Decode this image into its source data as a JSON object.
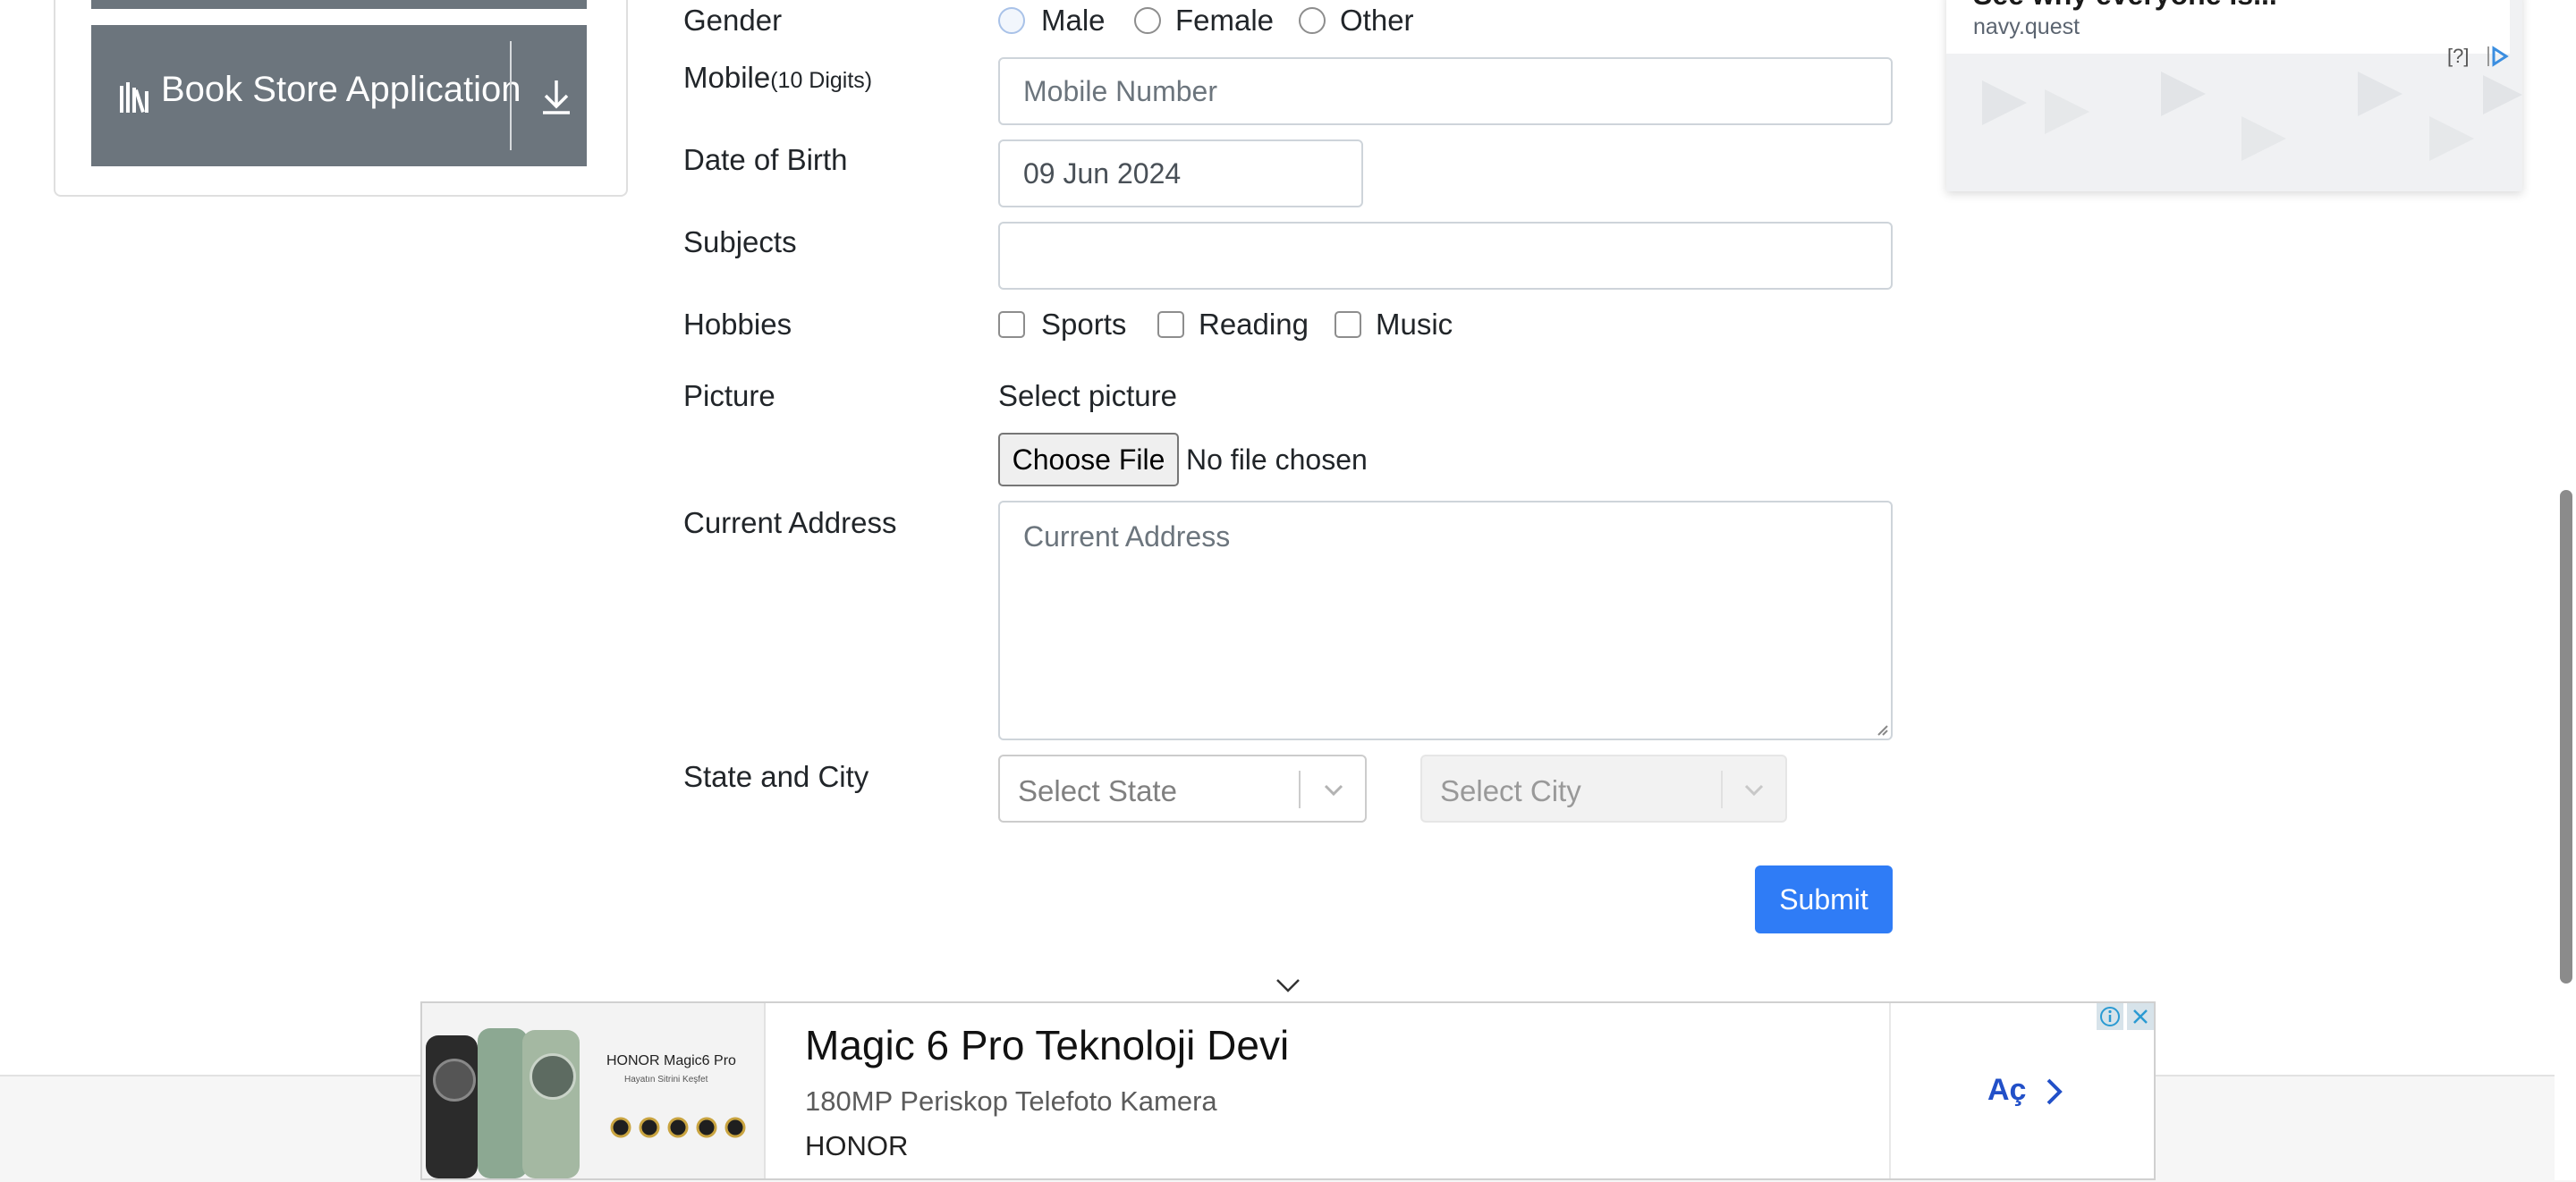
{
  "sidebar": {
    "book_store_label": "Book Store Application"
  },
  "form": {
    "gender": {
      "label": "Gender",
      "options": [
        "Male",
        "Female",
        "Other"
      ]
    },
    "mobile": {
      "label": "Mobile",
      "hint": "(10 Digits)",
      "placeholder": "Mobile Number"
    },
    "dob": {
      "label": "Date of Birth",
      "value": "09 Jun 2024"
    },
    "subjects": {
      "label": "Subjects",
      "value": ""
    },
    "hobbies": {
      "label": "Hobbies",
      "options": [
        "Sports",
        "Reading",
        "Music"
      ]
    },
    "picture": {
      "label": "Picture",
      "select_label": "Select picture",
      "choose_button": "Choose File",
      "status": "No file chosen"
    },
    "address": {
      "label": "Current Address",
      "placeholder": "Current Address"
    },
    "state_city": {
      "label": "State and City",
      "state_placeholder": "Select State",
      "city_placeholder": "Select City"
    },
    "submit_label": "Submit"
  },
  "right_ad": {
    "headline": "See why everyone is...",
    "domain": "navy.quest",
    "help": "[?]"
  },
  "banner_ad": {
    "title": "Magic 6 Pro Teknoloji Devi",
    "subtitle": "180MP Periskop Telefoto Kamera",
    "brand": "HONOR",
    "product_tag": "HONOR Magic6 Pro",
    "product_tagline": "Hayatın Sitrini Keşfet",
    "cta": "Aç"
  },
  "colors": {
    "primary": "#2f7cf6",
    "secondary": "#6c757d",
    "cta_text": "#2250c8"
  }
}
